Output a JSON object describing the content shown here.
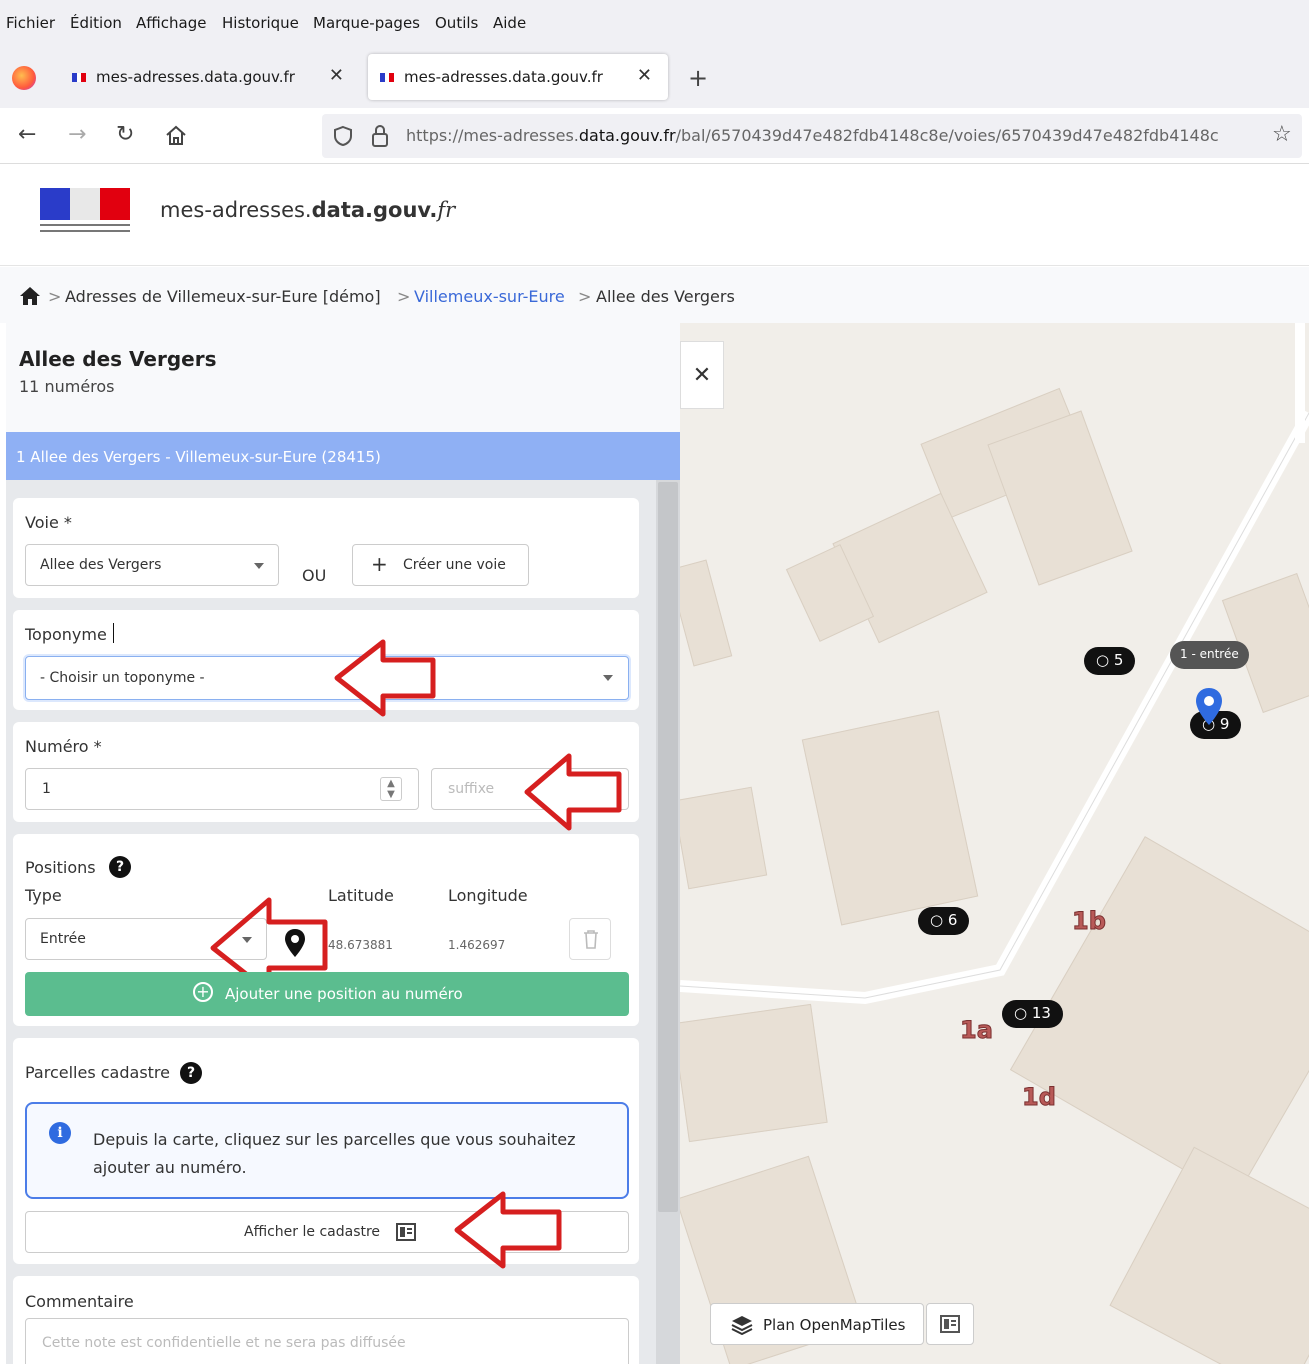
{
  "browser": {
    "menu": [
      "Fichier",
      "Édition",
      "Affichage",
      "Historique",
      "Marque-pages",
      "Outils",
      "Aide"
    ],
    "tabs": [
      {
        "title": "mes-adresses.data.gouv.fr"
      },
      {
        "title": "mes-adresses.data.gouv.fr"
      }
    ],
    "url_host": "https://mes-adresses.",
    "url_domain": "data.gouv.fr",
    "url_path": "/bal/6570439d47e482fdb4148c8e/voies/6570439d47e482fdb4148c"
  },
  "site": {
    "name_prefix": "mes-adresses.",
    "name_bold": "data.gouv.",
    "name_suffix": "fr"
  },
  "breadcrumb": {
    "sep": ">",
    "item1": "Adresses de Villemeux-sur-Eure [démo]",
    "item2": "Villemeux-sur-Eure",
    "item3": "Allee des Vergers"
  },
  "voie": {
    "title": "Allee des Vergers",
    "count": "11 numéros"
  },
  "address_bar": "1 Allee des Vergers - Villemeux-sur-Eure (28415)",
  "form": {
    "voie_label": "Voie *",
    "voie_value": "Allee des Vergers",
    "ou": "OU",
    "create_voie": "Créer une voie",
    "toponyme_label": "Toponyme",
    "toponyme_value": "- Choisir un toponyme -",
    "numero_label": "Numéro *",
    "numero_value": "1",
    "suffixe_placeholder": "suffixe",
    "positions_label": "Positions",
    "type_label": "Type",
    "latitude_label": "Latitude",
    "longitude_label": "Longitude",
    "type_value": "Entrée",
    "latitude_value": "48.673881",
    "longitude_value": "1.462697",
    "add_position": "Ajouter une position au numéro",
    "parcelles_label": "Parcelles cadastre",
    "info_text": "Depuis la carte, cliquez sur les parcelles que vous souhaitez ajouter au numéro.",
    "show_cadastre": "Afficher le cadastre",
    "commentaire_label": "Commentaire",
    "commentaire_placeholder": "Cette note est confidentielle et ne sera pas diffusée"
  },
  "map": {
    "markers": [
      {
        "label": "5"
      },
      {
        "label": "9"
      },
      {
        "label": "6"
      },
      {
        "label": "13"
      }
    ],
    "entree_label": "1 - entrée",
    "labels": [
      "1b",
      "1a",
      "1d"
    ],
    "style_button": "Plan OpenMapTiles"
  },
  "colors": {
    "address_bar": "#8fb0f4",
    "add_position": "#5bbd8f",
    "annotation_arrow": "#d61f1f"
  }
}
